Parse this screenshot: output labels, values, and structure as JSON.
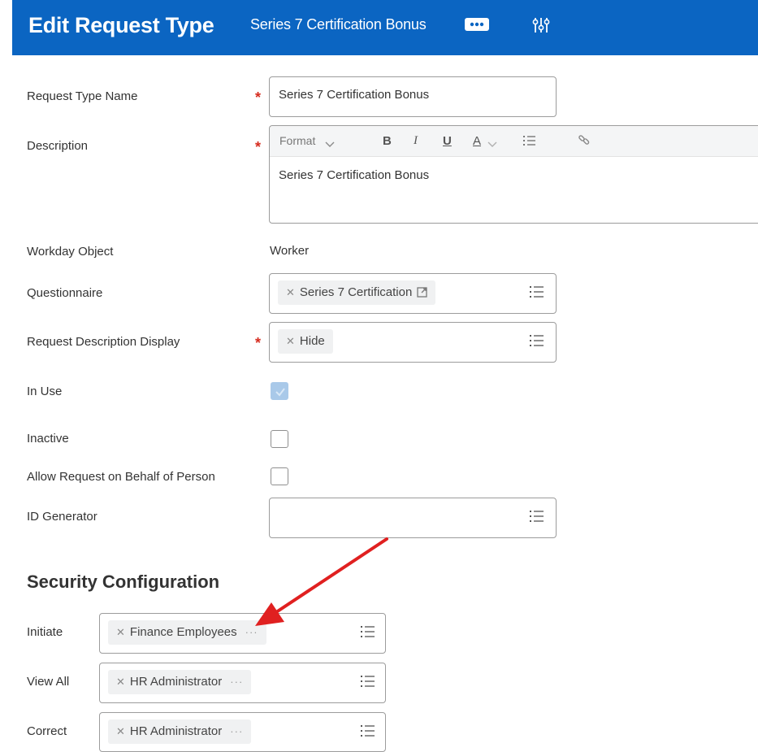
{
  "header": {
    "title": "Edit Request Type",
    "subtitle": "Series 7 Certification Bonus"
  },
  "fields": {
    "request_type_name": {
      "label": "Request Type Name",
      "value": "Series 7 Certification Bonus",
      "required": "*"
    },
    "description": {
      "label": "Description",
      "required": "*",
      "toolbar": {
        "format": "Format",
        "bold": "B",
        "italic": "I",
        "underline": "U",
        "font_color": "A"
      },
      "value": "Series 7 Certification Bonus"
    },
    "workday_object": {
      "label": "Workday Object",
      "value": "Worker"
    },
    "questionnaire": {
      "label": "Questionnaire",
      "value": "Series 7 Certification"
    },
    "request_description_display": {
      "label": "Request Description Display",
      "value": "Hide",
      "required": "*"
    },
    "in_use": {
      "label": "In Use",
      "checked": true
    },
    "inactive": {
      "label": "Inactive",
      "checked": false
    },
    "allow_behalf": {
      "label": "Allow Request on Behalf of Person",
      "checked": false
    },
    "id_generator": {
      "label": "ID Generator",
      "value": ""
    }
  },
  "security": {
    "title": "Security Configuration",
    "initiate": {
      "label": "Initiate",
      "value": "Finance Employees",
      "more": "···"
    },
    "view_all": {
      "label": "View All",
      "value": "HR Administrator",
      "more": "···"
    },
    "correct": {
      "label": "Correct",
      "value": "HR Administrator",
      "more": "···"
    }
  },
  "colors": {
    "header_bg": "#0b65c2",
    "required": "#d62c1f",
    "annotation_arrow": "#e02020"
  },
  "icons": {
    "header_more": "ellipsis-icon",
    "header_related": "related-actions-icon",
    "prompt": "list-icon",
    "pill_remove": "x-icon",
    "external_link": "external-link-icon"
  }
}
